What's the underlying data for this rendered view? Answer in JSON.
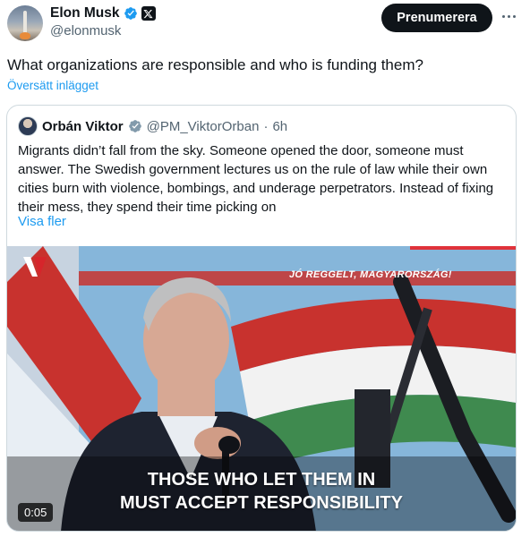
{
  "author": {
    "name": "Elon Musk",
    "handle": "@elonmusk",
    "verified_icon": "verified-badge-icon",
    "affiliate_icon": "x-logo-icon"
  },
  "actions": {
    "subscribe_label": "Prenumerera",
    "more_icon": "more-options-icon"
  },
  "tweet": {
    "text": "What organizations are responsible and who is funding them?",
    "translate_label": "Översätt inlägget"
  },
  "quoted": {
    "name": "Orbán Viktor",
    "handle": "@PM_ViktorOrban",
    "separator": "·",
    "time": "6h",
    "text": "Migrants didn’t fall from the sky. Someone opened the door, someone must answer. The Swedish government lectures us on the rule of law while their own cities burn with violence, bombings, and underage perpetrators. Instead of fixing their mess, they spend their time picking on",
    "show_more_label": "Visa fler",
    "video": {
      "banner": "JÓ REGGELT, MAGYARORSZÁG!",
      "caption_line1": "THOSE WHO LET THEM IN",
      "caption_line2": "MUST ACCEPT RESPONSIBILITY",
      "duration": "0:05"
    }
  },
  "colors": {
    "accent": "#1d9bf0",
    "text": "#0f1419",
    "muted": "#536471",
    "border": "#cfd9de"
  }
}
